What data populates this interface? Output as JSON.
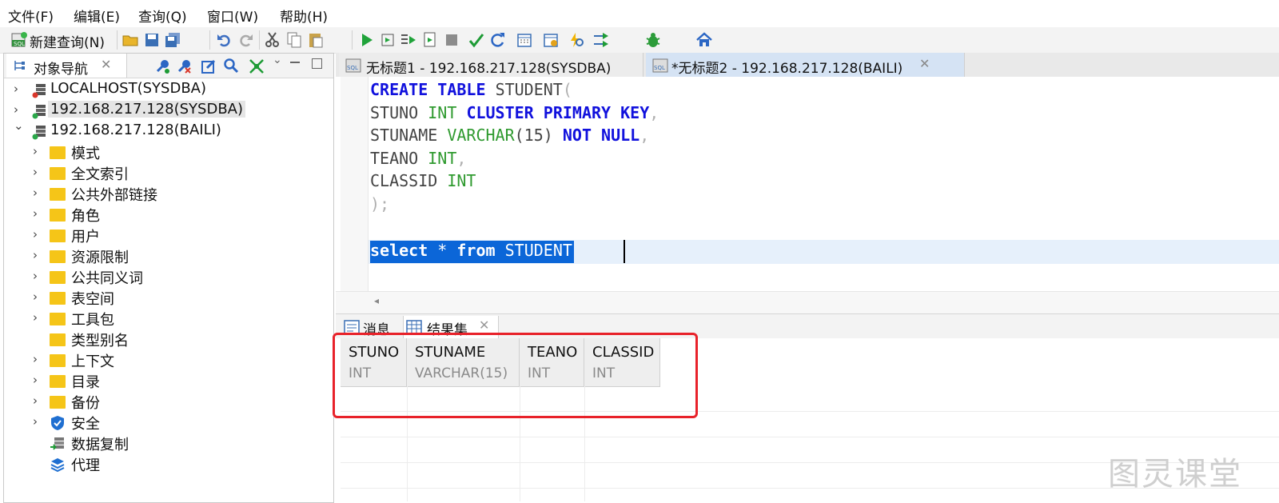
{
  "menubar": {
    "items": [
      "文件(F)",
      "编辑(E)",
      "查询(Q)",
      "窗口(W)",
      "帮助(H)"
    ]
  },
  "toolbar": {
    "new_query_label": "新建查询(N)"
  },
  "navigator": {
    "tab_label": "对象导航",
    "connections": [
      {
        "label": "LOCALHOST(SYSDBA)",
        "status_color": "#d9372b",
        "expanded": false
      },
      {
        "label": "192.168.217.128(SYSDBA)",
        "status_color": "#2ba84a",
        "expanded": false,
        "selected": true
      },
      {
        "label": "192.168.217.128(BAILI)",
        "status_color": "#2ba84a",
        "expanded": true
      }
    ],
    "children": [
      {
        "label": "模式",
        "icon": "folder-icon",
        "has_arrow": true
      },
      {
        "label": "全文索引",
        "icon": "folder-icon",
        "has_arrow": true
      },
      {
        "label": "公共外部链接",
        "icon": "folder-icon",
        "has_arrow": true
      },
      {
        "label": "角色",
        "icon": "folder-icon",
        "has_arrow": true
      },
      {
        "label": "用户",
        "icon": "folder-icon",
        "has_arrow": true
      },
      {
        "label": "资源限制",
        "icon": "folder-icon",
        "has_arrow": true
      },
      {
        "label": "公共同义词",
        "icon": "folder-icon",
        "has_arrow": true
      },
      {
        "label": "表空间",
        "icon": "folder-icon",
        "has_arrow": true
      },
      {
        "label": "工具包",
        "icon": "folder-icon",
        "has_arrow": true
      },
      {
        "label": "类型别名",
        "icon": "folder-icon",
        "has_arrow": false
      },
      {
        "label": "上下文",
        "icon": "folder-icon",
        "has_arrow": true
      },
      {
        "label": "目录",
        "icon": "folder-icon",
        "has_arrow": true
      },
      {
        "label": "备份",
        "icon": "folder-icon",
        "has_arrow": true
      },
      {
        "label": "安全",
        "icon": "shield-icon",
        "has_arrow": true
      },
      {
        "label": "数据复制",
        "icon": "replication-icon",
        "has_arrow": false
      },
      {
        "label": "代理",
        "icon": "layers-icon",
        "has_arrow": false
      }
    ]
  },
  "editor": {
    "tabs": [
      {
        "label": "无标题1 - 192.168.217.128(SYSDBA)",
        "active": false
      },
      {
        "label": "*无标题2 - 192.168.217.128(BAILI)",
        "active": true
      }
    ],
    "code": {
      "l1_kw1": "CREATE",
      "l1_kw2": "TABLE",
      "l1_name": "STUDENT",
      "l1_p": "(",
      "l2_col": "STUNO",
      "l2_type": "INT",
      "l2_kw1": "CLUSTER",
      "l2_kw2": "PRIMARY",
      "l2_kw3": "KEY",
      "l2_p": ",",
      "l3_col": "STUNAME",
      "l3_type": "VARCHAR",
      "l3_args": "(15)",
      "l3_kw1": "NOT",
      "l3_kw2": "NULL",
      "l3_p": ",",
      "l4_col": "TEANO",
      "l4_type": "INT",
      "l4_p": ",",
      "l5_col": "CLASSID",
      "l5_type": "INT",
      "l6_p": ");",
      "l8_kw1": "select",
      "l8_star": "*",
      "l8_kw2": "from",
      "l8_name": "STUDENT"
    }
  },
  "results": {
    "tabs": [
      "消息",
      "结果集"
    ],
    "columns": [
      {
        "name": "STUNO",
        "type": "INT"
      },
      {
        "name": "STUNAME",
        "type": "VARCHAR(15)"
      },
      {
        "name": "TEANO",
        "type": "INT"
      },
      {
        "name": "CLASSID",
        "type": "INT"
      }
    ]
  },
  "watermark": "图灵课堂",
  "colors": {
    "keyword": "#1111dd",
    "type": "#2f9a2f",
    "highlight": "#e6f0fb",
    "annotation_box": "#e8222a"
  }
}
